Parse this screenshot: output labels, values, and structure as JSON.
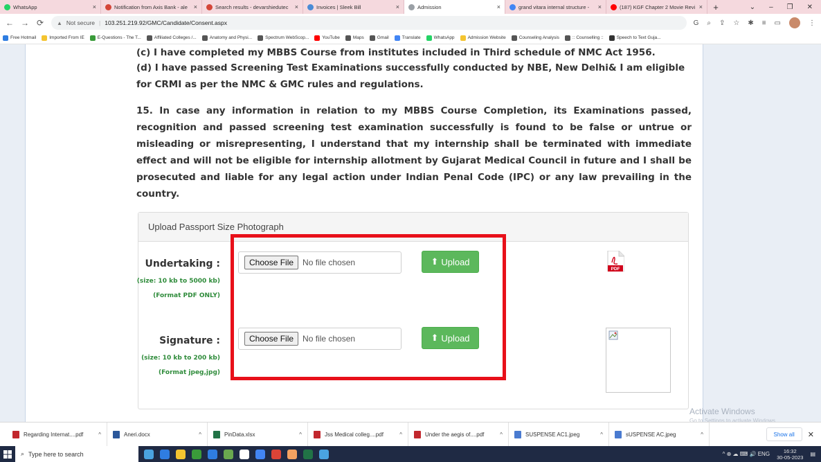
{
  "browser": {
    "tabs": [
      {
        "title": "WhatsApp",
        "color": "#25d366",
        "active": false
      },
      {
        "title": "Notification from Axis Bank - ale",
        "color": "#d44638",
        "active": false
      },
      {
        "title": "Search results - devarshiedutec",
        "color": "#d44638",
        "active": false
      },
      {
        "title": "Invoices | Sleek Bill",
        "color": "#4a8bd6",
        "active": false
      },
      {
        "title": "Admission",
        "color": "#9aa0a6",
        "active": true
      },
      {
        "title": "grand vitara internal structure -",
        "color": "#4285f4",
        "active": false
      },
      {
        "title": "(187) KGF Chapter 2 Movie Revi",
        "color": "#ff0000",
        "active": false
      }
    ],
    "tab_close": "×",
    "new_tab": "+",
    "window_controls": {
      "chevron": "⌄",
      "minimize": "–",
      "restore": "❐",
      "close": "✕"
    },
    "address": {
      "security": "Not secure",
      "url": "103.251.219.92/GMC/Candidate/Consent.aspx"
    },
    "bookmarks": [
      {
        "label": "Free Hotmail",
        "color": "#2f7de1"
      },
      {
        "label": "Imported From IE",
        "color": "#f4c430"
      },
      {
        "label": "E-Questions - The T...",
        "color": "#3a9b3a"
      },
      {
        "label": "Affiliated Colleges /...",
        "color": "#555555"
      },
      {
        "label": "Anatomy and Physi...",
        "color": "#555555"
      },
      {
        "label": "Spectrum WebScop...",
        "color": "#555555"
      },
      {
        "label": "YouTube",
        "color": "#ff0000"
      },
      {
        "label": "Maps",
        "color": "#555555"
      },
      {
        "label": "Gmail",
        "color": "#555555"
      },
      {
        "label": "Translate",
        "color": "#4285f4"
      },
      {
        "label": "WhatsApp",
        "color": "#25d366"
      },
      {
        "label": "Admission Website",
        "color": "#f4c430"
      },
      {
        "label": "Counseling Analysis",
        "color": "#555555"
      },
      {
        "label": ":: Counselling ::",
        "color": "#555555"
      },
      {
        "label": "Speech to Text Guja...",
        "color": "#333333"
      }
    ]
  },
  "content": {
    "para_c": "(c) I have completed my MBBS Course from institutes included in Third schedule of NMC Act 1956.",
    "para_d": "(d) I have passed Screening Test Examinations successfully conducted by NBE, New Delhi& I am eligible for CRMI as per the NMC & GMC rules and regulations.",
    "para_15": "15. In case any information in relation to my MBBS Course Completion, its Examinations passed, recognition and passed screening test examination successfully is found to be false or untrue or misleading or misrepresenting, I understand that my internship shall be terminated with immediate effect and will not be eligible for internship allotment by Gujarat Medical Council in future and I shall be prosecuted and liable for any legal action under Indian Penal Code (IPC) or any law prevailing in the country."
  },
  "upload": {
    "panel_title": "Upload Passport Size Photograph",
    "undertaking": {
      "label": "Undertaking :",
      "hint": "(size: 10 kb to 5000 kb) (Format PDF ONLY)",
      "choose_label": "Choose File",
      "status": "No file chosen",
      "upload_label": "Upload"
    },
    "signature": {
      "label": "Signature :",
      "hint": "(size: 10 kb to 200 kb) (Format jpeg,jpg)",
      "choose_label": "Choose File",
      "status": "No file chosen",
      "upload_label": "Upload"
    },
    "pdf_icon_text": "PDF",
    "upload_color": "#5cb85c",
    "highlight_color": "#e8101a"
  },
  "watermark": {
    "title": "Activate Windows",
    "subtitle": "Go to Settings to activate Windows."
  },
  "downloads": {
    "items": [
      {
        "name": "Regarding Internat....pdf",
        "color": "#c2272d"
      },
      {
        "name": "Aneri.docx",
        "color": "#2b579a"
      },
      {
        "name": "PinData.xlsx",
        "color": "#217346"
      },
      {
        "name": "Jss Medical colleg....pdf",
        "color": "#c2272d"
      },
      {
        "name": "Under the aegis of....pdf",
        "color": "#c2272d"
      },
      {
        "name": "SUSPENSE AC1.jpeg",
        "color": "#4a7bd0"
      },
      {
        "name": "sUSPENSE AC.jpeg",
        "color": "#4a7bd0"
      }
    ],
    "caret": "^",
    "show_all": "Show all",
    "close": "✕"
  },
  "taskbar": {
    "search_placeholder": "Type here to search",
    "apps": [
      "#4aa3e0",
      "#2f7de1",
      "#f4c430",
      "#3a9b3a",
      "#2f7de1",
      "#6aa84f",
      "#ffffff",
      "#4285f4",
      "#db4437",
      "#f4a261",
      "#217346",
      "#4aa3e0"
    ],
    "tray_text": "^ ⊕ ☁ ⌨ 🔊 ENG",
    "time": "16:32",
    "date": "30-05-2023"
  }
}
